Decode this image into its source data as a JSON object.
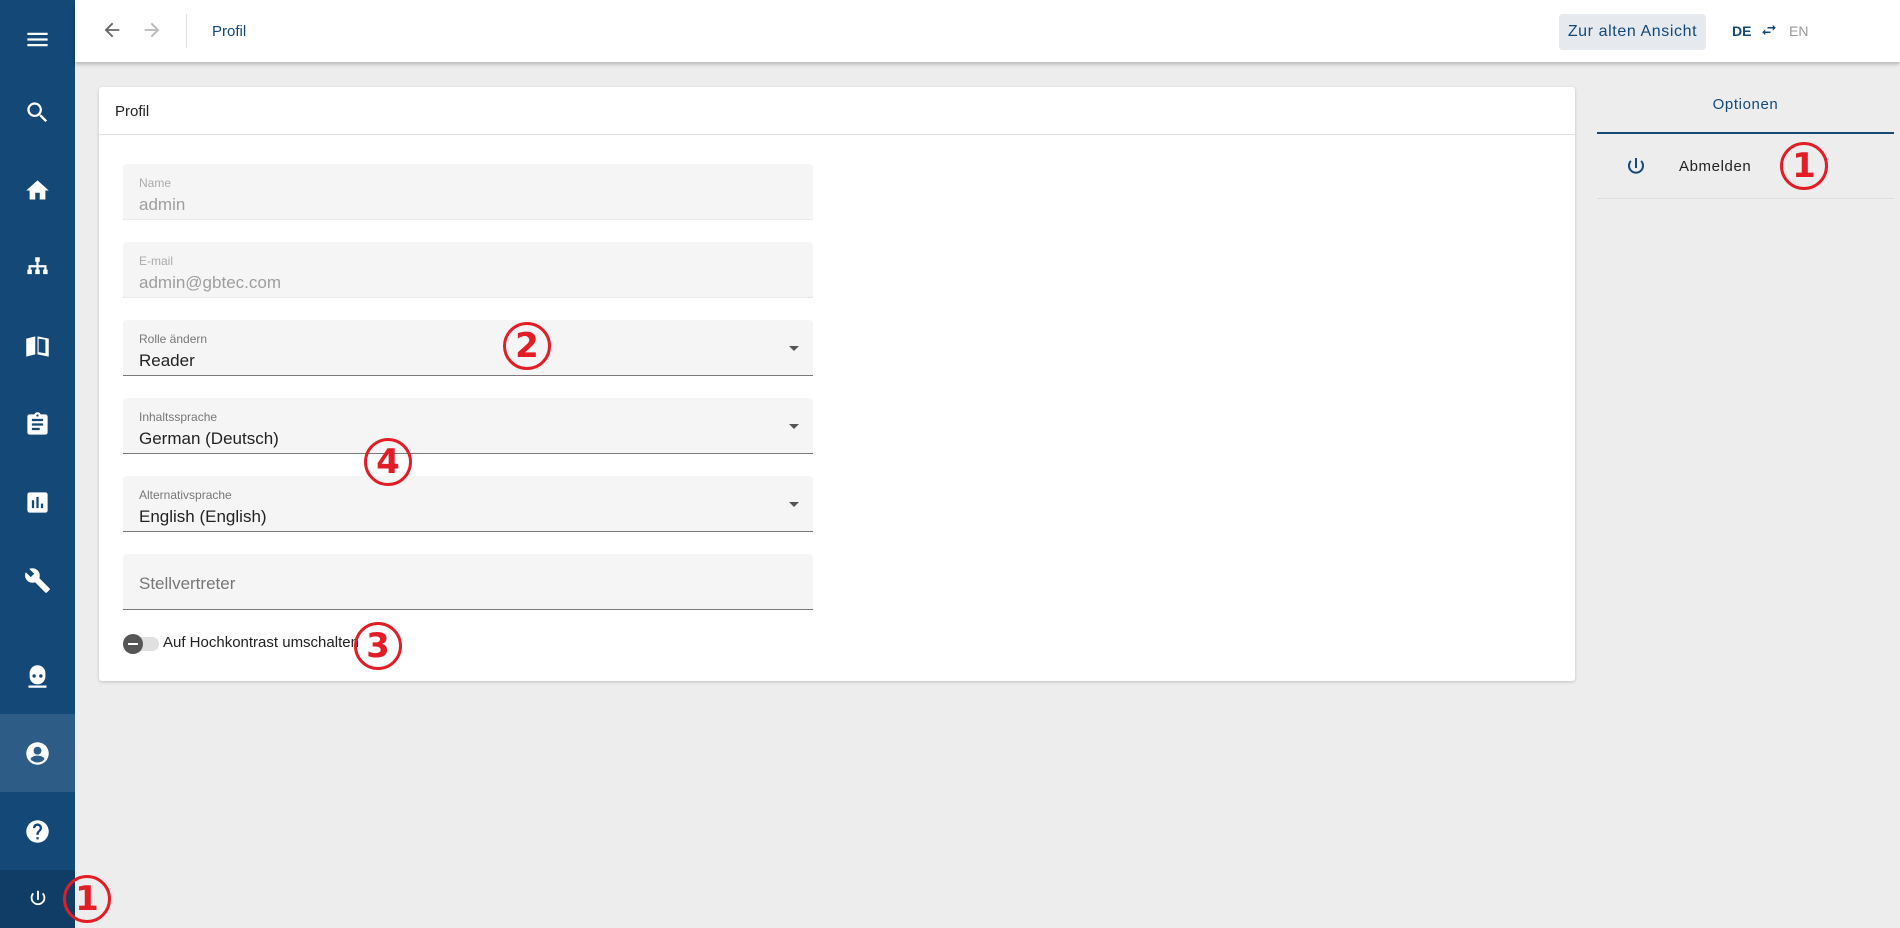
{
  "topbar": {
    "breadcrumb": "Profil",
    "old_view_button": "Zur alten Ansicht",
    "lang_current": "DE",
    "lang_other": "EN"
  },
  "sidebar": {
    "items": [
      {
        "name": "menu-icon"
      },
      {
        "name": "search-icon"
      },
      {
        "name": "home-icon"
      },
      {
        "name": "sitemap-icon"
      },
      {
        "name": "book-icon"
      },
      {
        "name": "clipboard-icon"
      },
      {
        "name": "chart-icon"
      },
      {
        "name": "wrench-icon"
      },
      {
        "name": "robot-icon"
      },
      {
        "name": "account-circle-icon"
      },
      {
        "name": "help-icon"
      },
      {
        "name": "power-icon"
      }
    ]
  },
  "profile": {
    "title": "Profil",
    "name": {
      "label": "Name",
      "value": "admin"
    },
    "email": {
      "label": "E-mail",
      "value": "admin@gbtec.com"
    },
    "role": {
      "label": "Rolle ändern",
      "value": "Reader"
    },
    "content_language": {
      "label": "Inhaltssprache",
      "value": "German (Deutsch)"
    },
    "alt_language": {
      "label": "Alternativsprache",
      "value": "English (English)"
    },
    "deputy": {
      "placeholder": "Stellvertreter"
    },
    "high_contrast_label": "Auf Hochkontrast umschalten"
  },
  "options": {
    "tab_label": "Optionen",
    "logout_label": "Abmelden"
  },
  "annotations": {
    "m1": "1",
    "m2": "2",
    "m3": "3",
    "m4": "4"
  },
  "colors": {
    "brand": "#134877",
    "annotation": "#e21d26",
    "background": "#ededed"
  }
}
